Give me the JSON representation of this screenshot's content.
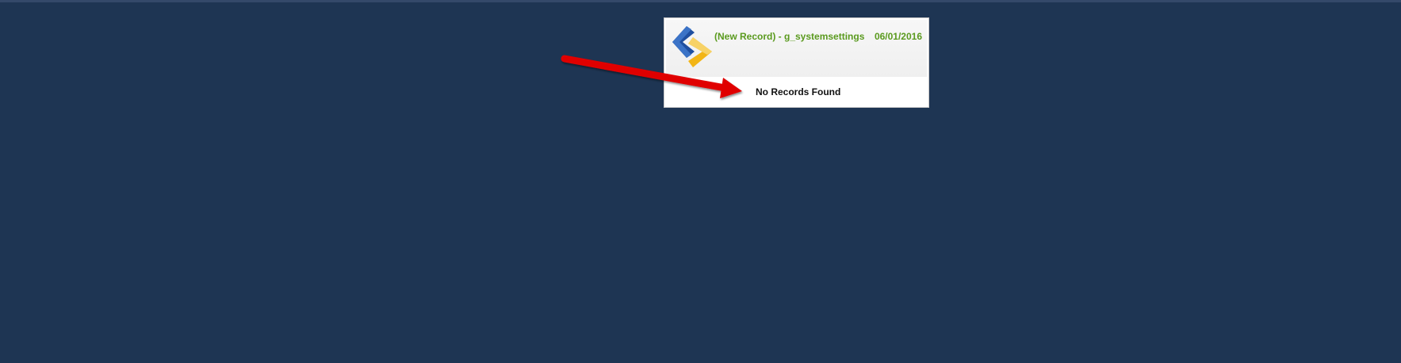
{
  "record": {
    "title": "(New Record) - g_systemsettings",
    "date": "06/01/2016",
    "message": "No Records Found"
  },
  "icons": {
    "logo": "nav-chevrons-logo-icon",
    "annotation": "red-arrow-icon"
  },
  "colors": {
    "background": "#1e3553",
    "title": "#5a9a1e",
    "arrow": "#e00000",
    "logo_blue": "#1f4fa0",
    "logo_yellow": "#f2b516"
  }
}
